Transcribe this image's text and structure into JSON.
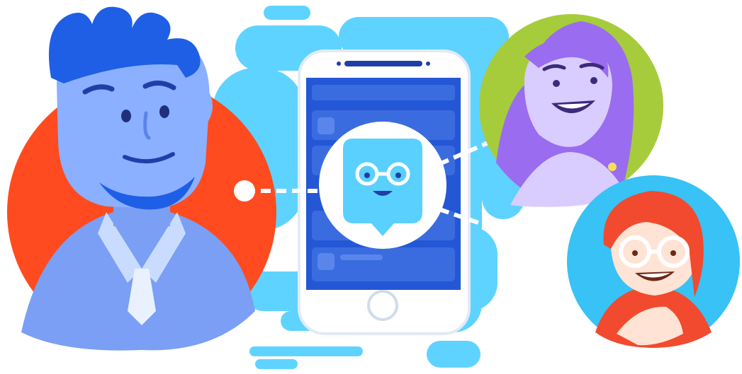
{
  "illustration": {
    "colors": {
      "background": "#ffffff",
      "splash": "#5fd3ff",
      "splash_light": "#8fe2ff",
      "phone_body": "#ffffff",
      "phone_outline": "#e3eaf5",
      "phone_screen": "#2357d6",
      "screen_card": "#3a6ce0",
      "connector": "#ffffff",
      "teacher_bg": "#ff4b1f",
      "teacher_skin": "#8ab0ff",
      "teacher_hair": "#1f5fe6",
      "woman_bg": "#a7cc3b",
      "woman_skin": "#d9ccff",
      "woman_hair": "#9a6cf0",
      "kid_bg": "#38c2f5",
      "kid_skin": "#ffe3d4",
      "kid_hair": "#f14a2e",
      "mascot_body": "#5ad0ff",
      "mascot_badge": "#ffffff"
    },
    "icons": [
      "speech-bubble-mascot-icon",
      "home-button-icon"
    ]
  }
}
